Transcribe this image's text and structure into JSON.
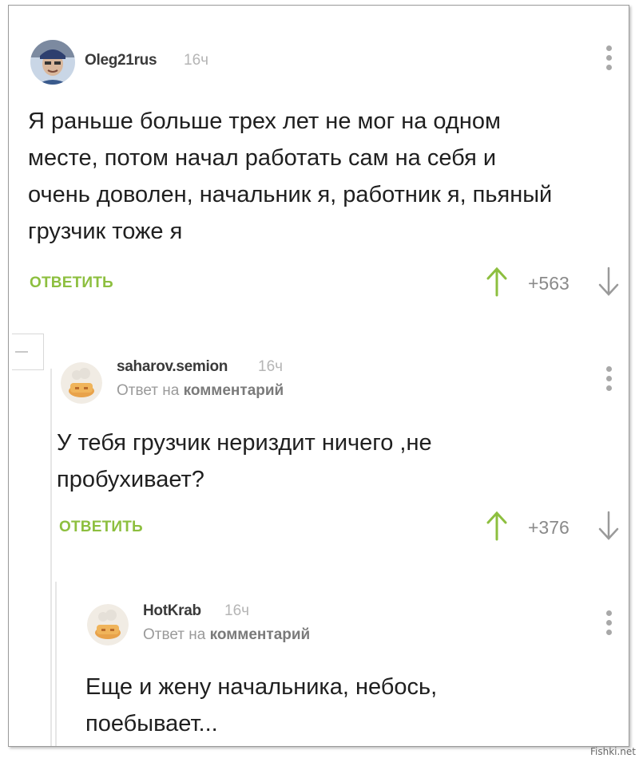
{
  "comments": [
    {
      "username": "Oleg21rus",
      "time": "16ч",
      "text_lines": [
        "Я раньше больше трех лет не мог на одном",
        "месте, потом начал работать сам на себя и",
        "очень доволен, начальник я, работник я, пьяный",
        "грузчик тоже я"
      ],
      "reply_label": "ОТВЕТИТЬ",
      "rating": "+563"
    },
    {
      "username": "saharov.semion",
      "time": "16ч",
      "reply_prefix": "Ответ на ",
      "reply_target": "комментарий",
      "text_lines": [
        "У тебя грузчик неpиздит ничего ,не",
        "пробухивает?"
      ],
      "reply_label": "ОТВЕТИТЬ",
      "rating": "+376"
    },
    {
      "username": "HotKrab",
      "time": "16ч",
      "reply_prefix": "Ответ на ",
      "reply_target": "комментарий",
      "text_lines": [
        "Еще и жену начальника, небось,",
        "поебывает..."
      ]
    }
  ],
  "watermark": "Fishki.net",
  "colors": {
    "accent_green": "#8dbf3f",
    "muted_gray": "#9a9a9a"
  }
}
